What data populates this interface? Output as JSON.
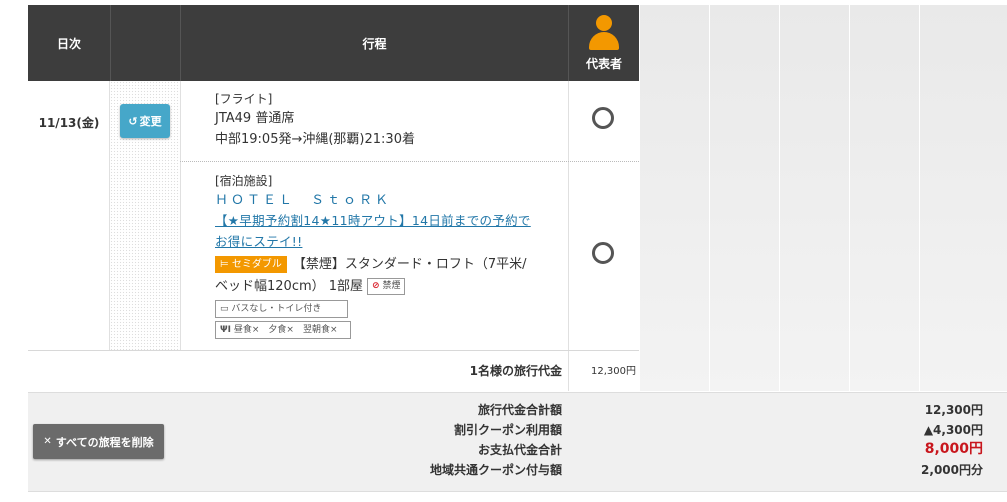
{
  "header": {
    "day_label": "日次",
    "itinerary_label": "行程",
    "representative_label": "代表者"
  },
  "day": "11/13(金)",
  "change_button": {
    "label": "変更",
    "icon": "undo-arrow-icon"
  },
  "flight": {
    "category": "[フライト]",
    "flight_info": "JTA49 普通席",
    "route": "中部19:05発→沖縄(那覇)21:30着"
  },
  "hotel": {
    "category": "[宿泊施設]",
    "name": "ＨＯＴＥＬ　ＳｔｏＲＫ",
    "plan_line1": "【★早期予約割14★11時アウト】14日前までの予約で",
    "plan_line2": "お得にステイ!!",
    "room_badge": "セミダブル",
    "room_line1": "【禁煙】スタンダード・ロフト（7平米/",
    "room_line2": "ベッド幅120cm） 1部屋",
    "smoking_tag": "禁煙",
    "bath_tag": "バスなし・トイレ付き",
    "meal_tag": "昼食×　夕食×　翌朝食×"
  },
  "subtotal": {
    "label": "1名様の旅行代金",
    "value": "12,300円"
  },
  "summary": {
    "delete_button": "すべての旅程を削除",
    "labels": [
      "旅行代金合計額",
      "割引クーポン利用額",
      "お支払代金合計",
      "地域共通クーポン付与額"
    ],
    "values": [
      "12,300円",
      "▲4,300円",
      "8,000円",
      "2,000円分"
    ]
  },
  "colors": {
    "header_bg": "#3d3d3d",
    "accent_orange": "#f39800",
    "change_button": "#46a7c9",
    "link": "#2277a8",
    "total_red": "#c8161d"
  }
}
